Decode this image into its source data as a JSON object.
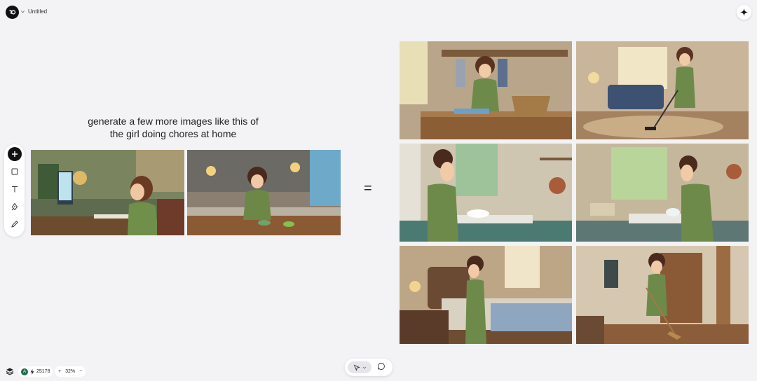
{
  "header": {
    "doc_title": "Untitled",
    "logo_icon": "logo-icon",
    "menu_icon": "chevron-down-icon",
    "ai_icon": "sparkle-icon"
  },
  "toolbar": {
    "items": [
      {
        "name": "add",
        "icon": "plus-icon"
      },
      {
        "name": "frame",
        "icon": "square-icon"
      },
      {
        "name": "text",
        "icon": "text-icon"
      },
      {
        "name": "pen",
        "icon": "pen-icon"
      },
      {
        "name": "pencil",
        "icon": "pencil-icon"
      }
    ]
  },
  "canvas": {
    "prompt_line1": "generate a few more images like this of",
    "prompt_line2": "the girl doing chores at home",
    "equals": "=",
    "input_images": [
      {
        "scene": "girl at computer desk"
      },
      {
        "scene": "girl preparing food in kitchen"
      }
    ],
    "output_images": [
      {
        "scene": "girl folding laundry"
      },
      {
        "scene": "girl vacuuming living room"
      },
      {
        "scene": "girl washing dishes"
      },
      {
        "scene": "girl washing dishes at window sink"
      },
      {
        "scene": "girl making bed"
      },
      {
        "scene": "girl sweeping hallway"
      }
    ]
  },
  "footer": {
    "avatar_initial": "A",
    "credits": "25178",
    "zoom_in": "+",
    "zoom": "32%",
    "zoom_out": "−"
  },
  "colors": {
    "background": "#f3f3f5",
    "accent": "#111111",
    "avatar": "#1f6f4a"
  }
}
